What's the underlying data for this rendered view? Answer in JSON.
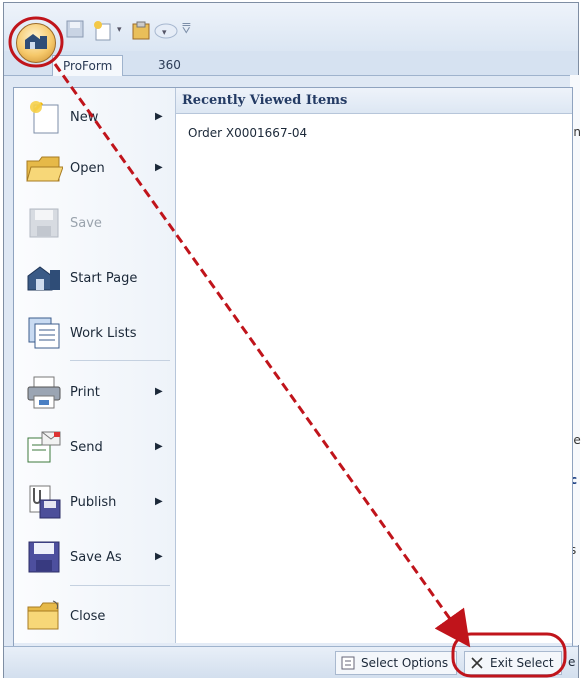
{
  "tabs": [
    {
      "label": "ProForm"
    },
    {
      "label": "360"
    }
  ],
  "qat_separator": "⩢",
  "app_menu": {
    "items": [
      {
        "label": "New",
        "icon": "new-document-icon",
        "submenu": true
      },
      {
        "label": "Open",
        "icon": "open-folder-icon",
        "submenu": true
      },
      {
        "label": "Save",
        "icon": "save-disk-icon",
        "disabled": true
      },
      {
        "label": "Start Page",
        "icon": "home-icon"
      },
      {
        "label": "Work Lists",
        "icon": "work-lists-icon"
      },
      {
        "label": "Print",
        "icon": "printer-icon",
        "submenu": true
      },
      {
        "label": "Send",
        "icon": "send-icon",
        "submenu": true
      },
      {
        "label": "Publish",
        "icon": "publish-icon",
        "submenu": true
      },
      {
        "label": "Save As",
        "icon": "save-as-icon",
        "submenu": true
      },
      {
        "label": "Close",
        "icon": "close-folder-icon"
      }
    ],
    "recent": {
      "heading": "Recently Viewed Items",
      "items": [
        "Order X0001667-04"
      ]
    },
    "footer": {
      "select_options_label": "Select Options",
      "exit_select_label": "Exit Select"
    }
  },
  "background_fragments": [
    "in",
    "le",
    "c",
    "s",
    "e"
  ],
  "colors": {
    "annotation_red": "#c0141b",
    "menu_header_text": "#243b64",
    "orb_gold": "#f6c96b"
  }
}
